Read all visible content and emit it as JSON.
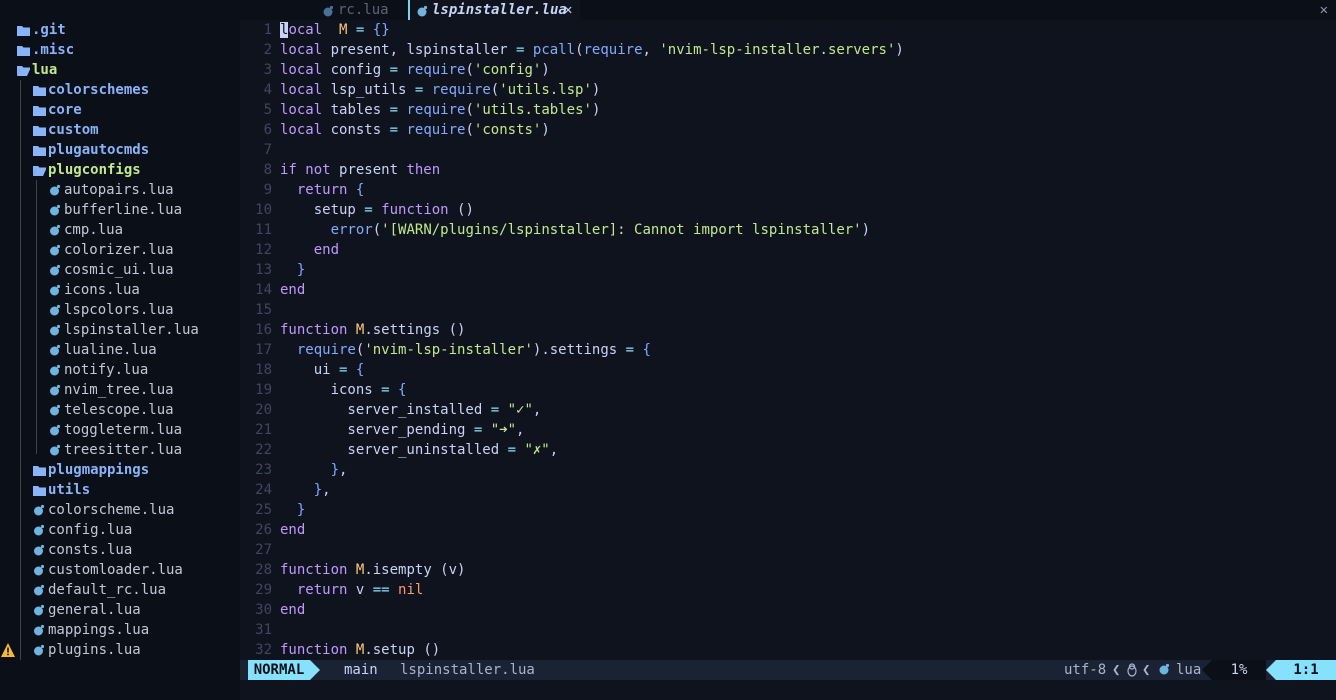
{
  "tree": {
    "items": [
      {
        "label": ".git",
        "kind": "dir",
        "depth": 0,
        "open": false
      },
      {
        "label": ".misc",
        "kind": "dir",
        "depth": 0,
        "open": false
      },
      {
        "label": "lua",
        "kind": "dir",
        "depth": 0,
        "open": true
      },
      {
        "label": "colorschemes",
        "kind": "dir",
        "depth": 1,
        "open": false
      },
      {
        "label": "core",
        "kind": "dir",
        "depth": 1,
        "open": false
      },
      {
        "label": "custom",
        "kind": "dir",
        "depth": 1,
        "open": false
      },
      {
        "label": "plugautocmds",
        "kind": "dir",
        "depth": 1,
        "open": false
      },
      {
        "label": "plugconfigs",
        "kind": "dir",
        "depth": 1,
        "open": true
      },
      {
        "label": "autopairs.lua",
        "kind": "file",
        "depth": 2
      },
      {
        "label": "bufferline.lua",
        "kind": "file",
        "depth": 2
      },
      {
        "label": "cmp.lua",
        "kind": "file",
        "depth": 2
      },
      {
        "label": "colorizer.lua",
        "kind": "file",
        "depth": 2
      },
      {
        "label": "cosmic_ui.lua",
        "kind": "file",
        "depth": 2
      },
      {
        "label": "icons.lua",
        "kind": "file",
        "depth": 2
      },
      {
        "label": "lspcolors.lua",
        "kind": "file",
        "depth": 2
      },
      {
        "label": "lspinstaller.lua",
        "kind": "file",
        "depth": 2
      },
      {
        "label": "lualine.lua",
        "kind": "file",
        "depth": 2
      },
      {
        "label": "notify.lua",
        "kind": "file",
        "depth": 2
      },
      {
        "label": "nvim_tree.lua",
        "kind": "file",
        "depth": 2
      },
      {
        "label": "telescope.lua",
        "kind": "file",
        "depth": 2
      },
      {
        "label": "toggleterm.lua",
        "kind": "file",
        "depth": 2
      },
      {
        "label": "treesitter.lua",
        "kind": "file",
        "depth": 2
      },
      {
        "label": "plugmappings",
        "kind": "dir",
        "depth": 1,
        "open": false
      },
      {
        "label": "utils",
        "kind": "dir",
        "depth": 1,
        "open": false
      },
      {
        "label": "colorscheme.lua",
        "kind": "file",
        "depth": 1
      },
      {
        "label": "config.lua",
        "kind": "file",
        "depth": 1
      },
      {
        "label": "consts.lua",
        "kind": "file",
        "depth": 1
      },
      {
        "label": "customloader.lua",
        "kind": "file",
        "depth": 1
      },
      {
        "label": "default_rc.lua",
        "kind": "file",
        "depth": 1
      },
      {
        "label": "general.lua",
        "kind": "file",
        "depth": 1
      },
      {
        "label": "mappings.lua",
        "kind": "file",
        "depth": 1
      },
      {
        "label": "plugins.lua",
        "kind": "file",
        "depth": 1
      }
    ]
  },
  "tabs": [
    {
      "label": "rc.lua",
      "close": "✕",
      "active": false
    },
    {
      "label": "lspinstaller.lua",
      "close": "✕",
      "active": true
    }
  ],
  "tabline_close": "✕",
  "editor": {
    "lines": [
      [
        [
          "cursor",
          "l"
        ],
        [
          "k",
          "ocal"
        ],
        [
          "",
          "  "
        ],
        [
          "var",
          "M"
        ],
        [
          "",
          " "
        ],
        [
          "op",
          "="
        ],
        [
          "",
          " "
        ],
        [
          "br",
          "{}"
        ]
      ],
      [
        [
          "k",
          "local"
        ],
        [
          "",
          " present, lspinstaller "
        ],
        [
          "op",
          "="
        ],
        [
          "",
          " "
        ],
        [
          "fn",
          "pcall"
        ],
        [
          "",
          "("
        ],
        [
          "fn",
          "require"
        ],
        [
          "",
          ", "
        ],
        [
          "str",
          "'nvim-lsp-installer.servers'"
        ],
        [
          "",
          ")"
        ]
      ],
      [
        [
          "k",
          "local"
        ],
        [
          "",
          " config "
        ],
        [
          "op",
          "="
        ],
        [
          "",
          " "
        ],
        [
          "fn",
          "require"
        ],
        [
          "",
          "("
        ],
        [
          "str",
          "'config'"
        ],
        [
          "",
          ")"
        ]
      ],
      [
        [
          "k",
          "local"
        ],
        [
          "",
          " lsp_utils "
        ],
        [
          "op",
          "="
        ],
        [
          "",
          " "
        ],
        [
          "fn",
          "require"
        ],
        [
          "",
          "("
        ],
        [
          "str",
          "'utils.lsp'"
        ],
        [
          "",
          ")"
        ]
      ],
      [
        [
          "k",
          "local"
        ],
        [
          "",
          " tables "
        ],
        [
          "op",
          "="
        ],
        [
          "",
          " "
        ],
        [
          "fn",
          "require"
        ],
        [
          "",
          "("
        ],
        [
          "str",
          "'utils.tables'"
        ],
        [
          "",
          ")"
        ]
      ],
      [
        [
          "k",
          "local"
        ],
        [
          "",
          " consts "
        ],
        [
          "op",
          "="
        ],
        [
          "",
          " "
        ],
        [
          "fn",
          "require"
        ],
        [
          "",
          "("
        ],
        [
          "str",
          "'consts'"
        ],
        [
          "",
          ")"
        ]
      ],
      [],
      [
        [
          "k",
          "if"
        ],
        [
          "",
          " "
        ],
        [
          "k",
          "not"
        ],
        [
          "",
          " present "
        ],
        [
          "k",
          "then"
        ]
      ],
      [
        [
          "",
          "  "
        ],
        [
          "ret",
          "return"
        ],
        [
          "",
          " "
        ],
        [
          "br",
          "{"
        ]
      ],
      [
        [
          "",
          "    setup "
        ],
        [
          "op",
          "="
        ],
        [
          "",
          " "
        ],
        [
          "k",
          "function"
        ],
        [
          "",
          " ()"
        ]
      ],
      [
        [
          "",
          "      "
        ],
        [
          "fn",
          "error"
        ],
        [
          "",
          "("
        ],
        [
          "str",
          "'[WARN/plugins/lspinstaller]: Cannot import lspinstaller'"
        ],
        [
          "",
          ")"
        ]
      ],
      [
        [
          "",
          "    "
        ],
        [
          "k",
          "end"
        ]
      ],
      [
        [
          "",
          "  "
        ],
        [
          "br",
          "}"
        ]
      ],
      [
        [
          "k",
          "end"
        ]
      ],
      [],
      [
        [
          "k",
          "function"
        ],
        [
          "",
          " "
        ],
        [
          "var",
          "M"
        ],
        [
          "",
          ".settings ()"
        ]
      ],
      [
        [
          "",
          "  "
        ],
        [
          "fn",
          "require"
        ],
        [
          "",
          "("
        ],
        [
          "str",
          "'nvim-lsp-installer'"
        ],
        [
          "",
          ").settings "
        ],
        [
          "op",
          "="
        ],
        [
          "",
          " "
        ],
        [
          "br",
          "{"
        ]
      ],
      [
        [
          "",
          "    ui "
        ],
        [
          "op",
          "="
        ],
        [
          "",
          " "
        ],
        [
          "br",
          "{"
        ]
      ],
      [
        [
          "",
          "      icons "
        ],
        [
          "op",
          "="
        ],
        [
          "",
          " "
        ],
        [
          "br",
          "{"
        ]
      ],
      [
        [
          "",
          "        server_installed "
        ],
        [
          "op",
          "="
        ],
        [
          "",
          " "
        ],
        [
          "str",
          "\"✓\""
        ],
        [
          "",
          ","
        ]
      ],
      [
        [
          "",
          "        server_pending "
        ],
        [
          "op",
          "="
        ],
        [
          "",
          " "
        ],
        [
          "str",
          "\"➜\""
        ],
        [
          "",
          ","
        ]
      ],
      [
        [
          "",
          "        server_uninstalled "
        ],
        [
          "op",
          "="
        ],
        [
          "",
          " "
        ],
        [
          "str",
          "\"✗\""
        ],
        [
          "",
          ","
        ]
      ],
      [
        [
          "",
          "      "
        ],
        [
          "br",
          "}"
        ],
        [
          "",
          ","
        ]
      ],
      [
        [
          "",
          "    "
        ],
        [
          "br",
          "}"
        ],
        [
          "",
          ","
        ]
      ],
      [
        [
          "",
          "  "
        ],
        [
          "br",
          "}"
        ]
      ],
      [
        [
          "k",
          "end"
        ]
      ],
      [],
      [
        [
          "k",
          "function"
        ],
        [
          "",
          " "
        ],
        [
          "var",
          "M"
        ],
        [
          "",
          ".isempty (v)"
        ]
      ],
      [
        [
          "",
          "  "
        ],
        [
          "ret",
          "return"
        ],
        [
          "",
          " v "
        ],
        [
          "op",
          "=="
        ],
        [
          "",
          " "
        ],
        [
          "nil",
          "nil"
        ]
      ],
      [
        [
          "k",
          "end"
        ]
      ],
      [],
      [
        [
          "k",
          "function"
        ],
        [
          "",
          " "
        ],
        [
          "var",
          "M"
        ],
        [
          "",
          ".setup ()"
        ]
      ]
    ]
  },
  "statusline": {
    "mode": "NORMAL",
    "branch_icon": "",
    "branch": "main",
    "filename": "lspinstaller.lua",
    "encoding": "utf-8",
    "os_icon": "🐧",
    "filetype": "lua",
    "percent": "1%",
    "position": "1:1"
  },
  "colors": {
    "background": "#0f131d",
    "accent": "#86e1fc",
    "keyword": "#c099ff",
    "string": "#c3e88d",
    "function": "#82aaff",
    "variable": "#ffc777"
  }
}
